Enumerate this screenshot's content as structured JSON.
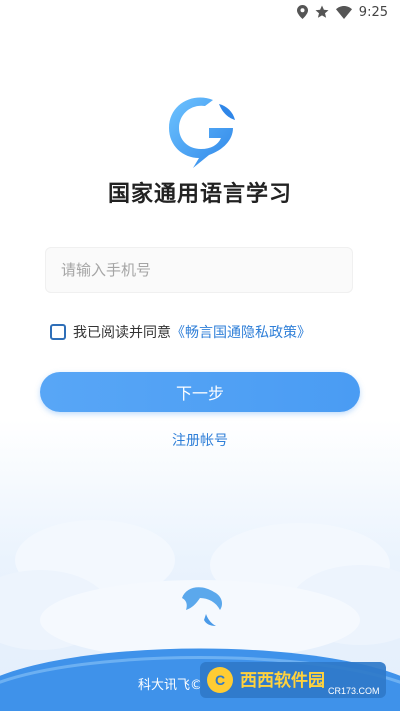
{
  "status_bar": {
    "time": "9:25",
    "icons": [
      "location-icon",
      "star-icon",
      "wifi-icon"
    ]
  },
  "app": {
    "title": "国家通用语言学习",
    "logo": "app-logo-icon"
  },
  "login": {
    "phone_placeholder": "请输入手机号",
    "agree_text": "我已阅读并同意",
    "policy_link": "《畅言国通隐私政策》",
    "agree_checked": false,
    "next_button": "下一步",
    "register_link": "注册帐号"
  },
  "footer": {
    "company": "科大讯飞©"
  },
  "watermark": {
    "brand": "西西软件园",
    "url": "CR173.COM"
  },
  "colors": {
    "primary": "#4a9cf3",
    "link": "#2f7fd8",
    "checkbox_border": "#2f6fb8"
  }
}
